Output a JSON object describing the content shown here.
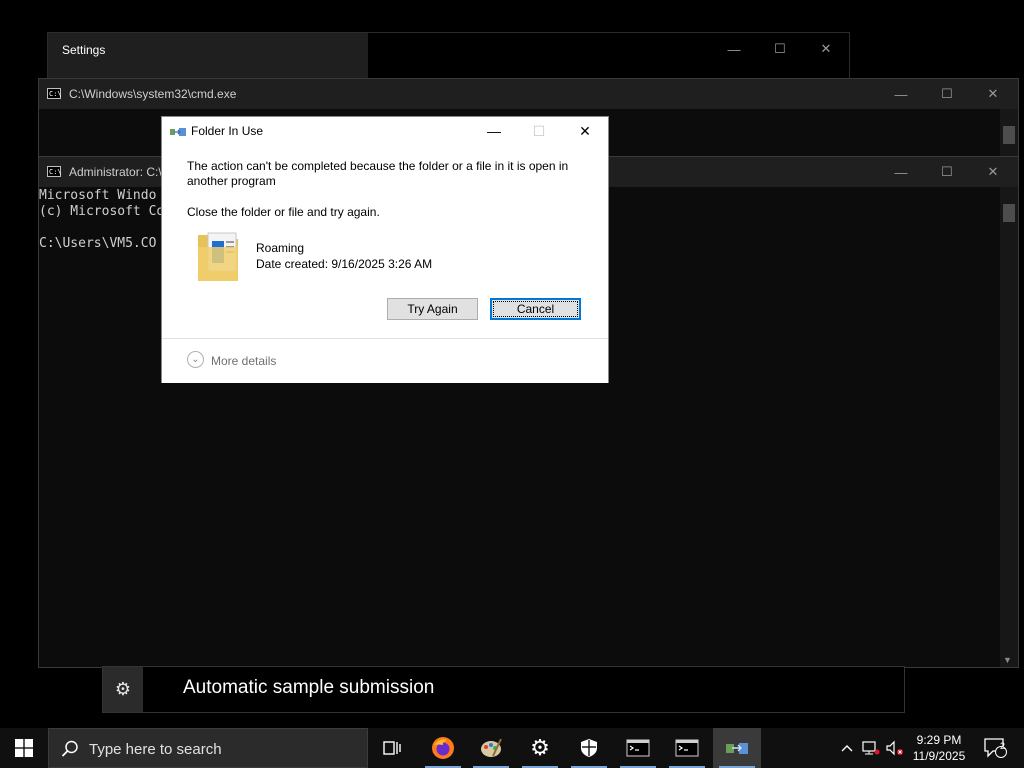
{
  "settings_window": {
    "title": "Settings"
  },
  "cmd_window_1": {
    "title": "C:\\Windows\\system32\\cmd.exe"
  },
  "cmd_window_2": {
    "title": "Administrator: C:\\",
    "lines": [
      "Microsoft Windo",
      "(c) Microsoft Co",
      "",
      "C:\\Users\\VM5.CO"
    ]
  },
  "banner": {
    "text": "Automatic sample submission"
  },
  "dialog": {
    "title": "Folder In Use",
    "message": "The action can't be completed because the folder or a file in it is open in another program",
    "instruction": "Close the folder or file and try again.",
    "file_name": "Roaming",
    "file_date": "Date created: 9/16/2025 3:26 AM",
    "try_again_label": "Try Again",
    "cancel_label": "Cancel",
    "more_details_label": "More details"
  },
  "taskbar": {
    "search_placeholder": "Type here to search",
    "time": "9:29 PM",
    "date": "11/9/2025",
    "notification_count": "2"
  },
  "colors": {
    "accent": "#0078d7",
    "taskbar_bg": "#101010"
  }
}
